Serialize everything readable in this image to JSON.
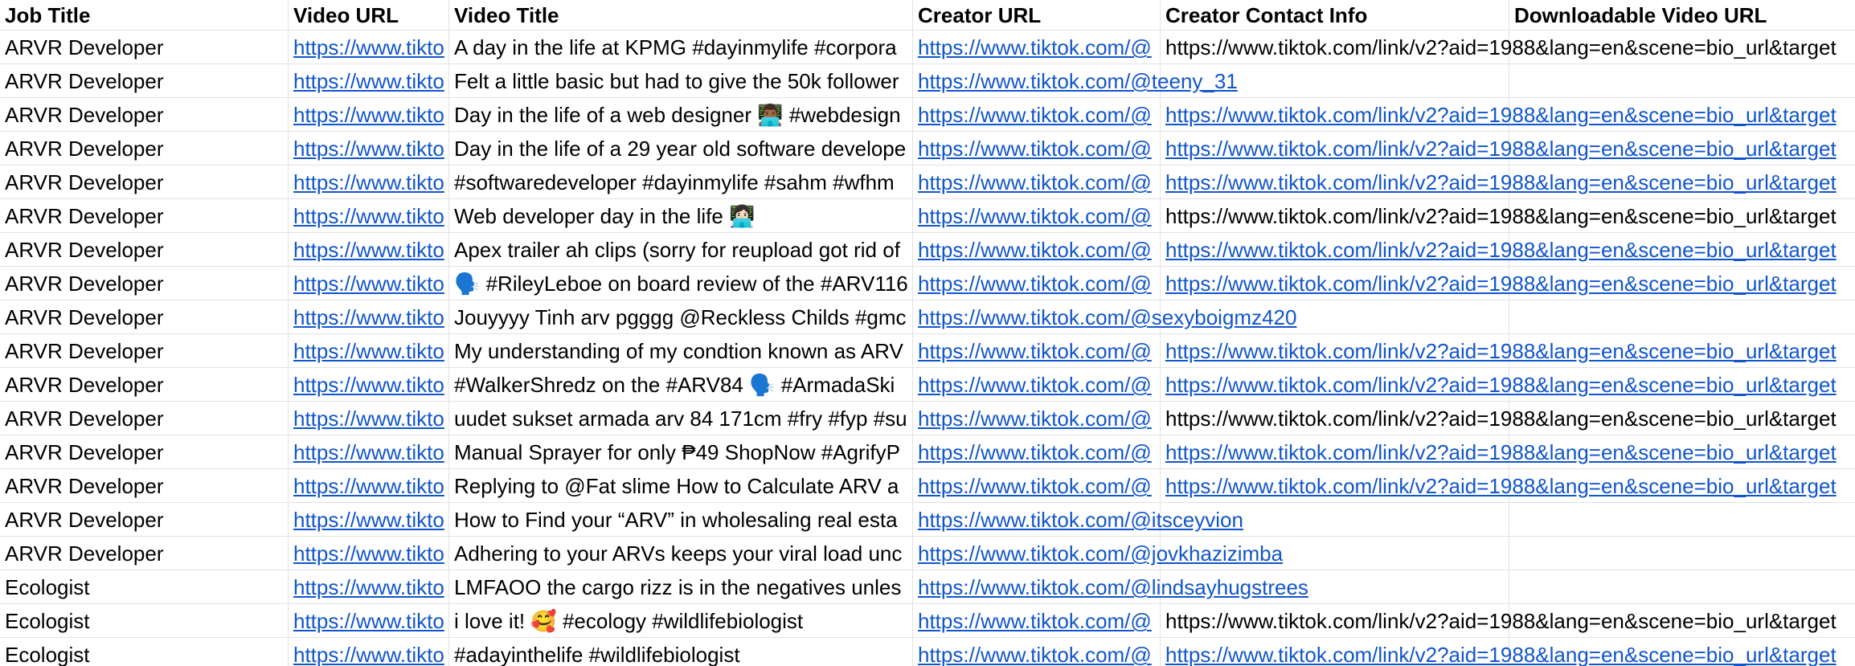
{
  "columns": [
    "Job Title",
    "Video URL",
    "Video Title",
    "Creator URL",
    "Creator Contact Info",
    "Downloadable Video URL"
  ],
  "rows": [
    {
      "job": "ARVR Developer",
      "video_url": "https://www.tikto",
      "title": "A day in the life at KPMG #dayinmylife #corpora",
      "creator": "https://www.tiktok.com/@",
      "creator_overflow": false,
      "contact": "https://www.tiktok.com/link/v2?aid=1988&lang=en&scene=bio_url&target",
      "contact_link": false
    },
    {
      "job": "ARVR Developer",
      "video_url": "https://www.tikto",
      "title": "Felt a little basic but had to give the 50k follower",
      "creator": "https://www.tiktok.com/@teeny_31",
      "creator_overflow": true,
      "contact": "",
      "contact_link": false
    },
    {
      "job": "ARVR Developer",
      "video_url": "https://www.tikto",
      "title": "Day in the life of a web designer 👨🏾‍💻 #webdesign",
      "creator": "https://www.tiktok.com/@",
      "creator_overflow": false,
      "contact": "https://www.tiktok.com/link/v2?aid=1988&lang=en&scene=bio_url&target",
      "contact_link": true
    },
    {
      "job": "ARVR Developer",
      "video_url": "https://www.tikto",
      "title": "Day in the life of a 29 year old software develope",
      "creator": "https://www.tiktok.com/@",
      "creator_overflow": false,
      "contact": "https://www.tiktok.com/link/v2?aid=1988&lang=en&scene=bio_url&target",
      "contact_link": true
    },
    {
      "job": "ARVR Developer",
      "video_url": "https://www.tikto",
      "title": "#softwaredeveloper #dayinmylife #sahm #wfhm",
      "creator": "https://www.tiktok.com/@",
      "creator_overflow": false,
      "contact": "https://www.tiktok.com/link/v2?aid=1988&lang=en&scene=bio_url&target",
      "contact_link": true
    },
    {
      "job": "ARVR Developer",
      "video_url": "https://www.tikto",
      "title": "Web developer day in the life 👩🏻‍💻",
      "creator": "https://www.tiktok.com/@",
      "creator_overflow": false,
      "contact": "https://www.tiktok.com/link/v2?aid=1988&lang=en&scene=bio_url&target",
      "contact_link": false
    },
    {
      "job": "ARVR Developer",
      "video_url": "https://www.tikto",
      "title": "Apex trailer ah clips (sorry for reupload got rid of",
      "creator": "https://www.tiktok.com/@",
      "creator_overflow": false,
      "contact": "https://www.tiktok.com/link/v2?aid=1988&lang=en&scene=bio_url&target",
      "contact_link": true
    },
    {
      "job": "ARVR Developer",
      "video_url": "https://www.tikto",
      "title": "🗣️ #RileyLeboe on board review of the #ARV116",
      "creator": "https://www.tiktok.com/@",
      "creator_overflow": false,
      "contact": "https://www.tiktok.com/link/v2?aid=1988&lang=en&scene=bio_url&target",
      "contact_link": true
    },
    {
      "job": "ARVR Developer",
      "video_url": "https://www.tikto",
      "title": "Jouyyyy Tinh arv pgggg @Reckless Childs #gmc",
      "creator": "https://www.tiktok.com/@sexyboigmz420",
      "creator_overflow": true,
      "contact": "",
      "contact_link": false
    },
    {
      "job": "ARVR Developer",
      "video_url": "https://www.tikto",
      "title": "My understanding of my condtion known as ARV",
      "creator": "https://www.tiktok.com/@",
      "creator_overflow": false,
      "contact": "https://www.tiktok.com/link/v2?aid=1988&lang=en&scene=bio_url&target",
      "contact_link": true
    },
    {
      "job": "ARVR Developer",
      "video_url": "https://www.tikto",
      "title": "#WalkerShredz on the #ARV84 🗣️ #ArmadaSki",
      "creator": "https://www.tiktok.com/@",
      "creator_overflow": false,
      "contact": "https://www.tiktok.com/link/v2?aid=1988&lang=en&scene=bio_url&target",
      "contact_link": true
    },
    {
      "job": "ARVR Developer",
      "video_url": "https://www.tikto",
      "title": "uudet sukset armada arv 84 171cm #fry #fyp #su",
      "creator": "https://www.tiktok.com/@",
      "creator_overflow": false,
      "contact": "https://www.tiktok.com/link/v2?aid=1988&lang=en&scene=bio_url&target",
      "contact_link": false
    },
    {
      "job": "ARVR Developer",
      "video_url": "https://www.tikto",
      "title": "Manual Sprayer for only ₱49 ShopNow #AgrifyP",
      "creator": "https://www.tiktok.com/@",
      "creator_overflow": false,
      "contact": "https://www.tiktok.com/link/v2?aid=1988&lang=en&scene=bio_url&target",
      "contact_link": true
    },
    {
      "job": "ARVR Developer",
      "video_url": "https://www.tikto",
      "title": "Replying to @Fat slime How to Calculate ARV a",
      "creator": "https://www.tiktok.com/@",
      "creator_overflow": false,
      "contact": "https://www.tiktok.com/link/v2?aid=1988&lang=en&scene=bio_url&target",
      "contact_link": true
    },
    {
      "job": "ARVR Developer",
      "video_url": "https://www.tikto",
      "title": "How to Find your “ARV” in wholesaling real esta",
      "creator": "https://www.tiktok.com/@itsceyvion",
      "creator_overflow": true,
      "contact": "",
      "contact_link": false
    },
    {
      "job": "ARVR Developer",
      "video_url": "https://www.tikto",
      "title": "Adhering to your ARVs keeps your viral load unc",
      "creator": "https://www.tiktok.com/@jovkhazizimba",
      "creator_overflow": true,
      "contact": "",
      "contact_link": false
    },
    {
      "job": "Ecologist",
      "video_url": "https://www.tikto",
      "title": "LMFAOO the cargo rizz is in the negatives unles",
      "creator": "https://www.tiktok.com/@lindsayhugstrees",
      "creator_overflow": true,
      "contact": "",
      "contact_link": false
    },
    {
      "job": "Ecologist",
      "video_url": "https://www.tikto",
      "title": "i love it! 🥰 #ecology #wildlifebiologist",
      "creator": "https://www.tiktok.com/@",
      "creator_overflow": false,
      "contact": "https://www.tiktok.com/link/v2?aid=1988&lang=en&scene=bio_url&target",
      "contact_link": false
    },
    {
      "job": "Ecologist",
      "video_url": "https://www.tikto",
      "title": "#adayinthelife #wildlifebiologist",
      "creator": "https://www.tiktok.com/@",
      "creator_overflow": false,
      "contact": "https://www.tiktok.com/link/v2?aid=1988&lang=en&scene=bio_url&target",
      "contact_link": true
    }
  ]
}
